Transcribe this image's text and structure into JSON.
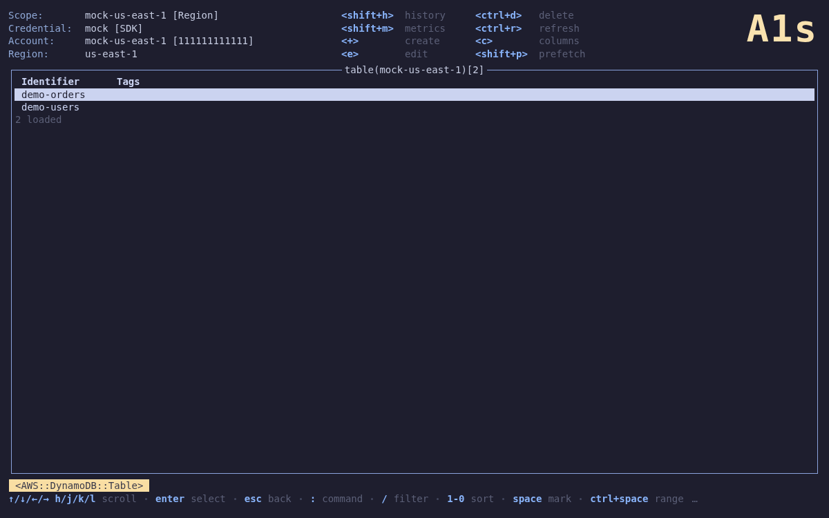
{
  "context": [
    {
      "label": "Scope:",
      "value": "mock-us-east-1 [Region]"
    },
    {
      "label": "Credential:",
      "value": "mock [SDK]"
    },
    {
      "label": "Account:",
      "value": "mock-us-east-1 [111111111111]"
    },
    {
      "label": "Region:",
      "value": "us-east-1"
    }
  ],
  "shortcuts": [
    [
      {
        "key": "<shift+h>",
        "action": "history"
      },
      {
        "key": "<shift+m>",
        "action": "metrics"
      },
      {
        "key": "<+>",
        "action": "create"
      },
      {
        "key": "<e>",
        "action": "edit"
      }
    ],
    [
      {
        "key": "<ctrl+d>",
        "action": "delete"
      },
      {
        "key": "<ctrl+r>",
        "action": "refresh"
      },
      {
        "key": "<c>",
        "action": "columns"
      },
      {
        "key": "<shift+p>",
        "action": "prefetch"
      }
    ]
  ],
  "logo": "A1s",
  "table": {
    "title": "table(mock-us-east-1)[2]",
    "columns": [
      "Identifier",
      "Tags"
    ],
    "rows": [
      {
        "cells": [
          "demo-orders"
        ],
        "selected": true
      },
      {
        "cells": [
          "demo-users"
        ],
        "selected": false
      }
    ],
    "status": "2 loaded"
  },
  "resource_badge": "<AWS::DynamoDB::Table>",
  "hints": [
    {
      "key": "↑/↓/←/→ h/j/k/l",
      "action": "scroll"
    },
    {
      "key": "enter",
      "action": "select"
    },
    {
      "key": "esc",
      "action": "back"
    },
    {
      "key": ":",
      "action": "command"
    },
    {
      "key": "/",
      "action": "filter"
    },
    {
      "key": "1-0",
      "action": "sort"
    },
    {
      "key": "space",
      "action": "mark"
    },
    {
      "key": "ctrl+space",
      "action": "range"
    }
  ],
  "hints_more": "…"
}
